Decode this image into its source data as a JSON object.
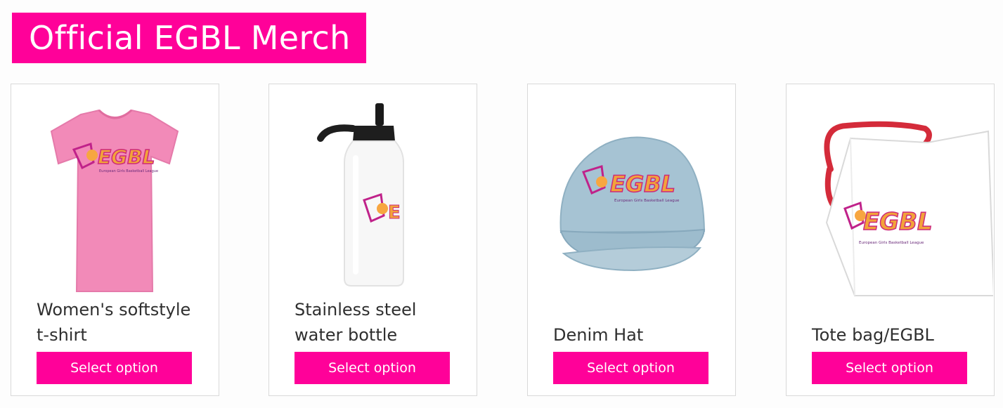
{
  "page": {
    "title": "Official EGBL Merch"
  },
  "colors": {
    "brand": "#ff0199",
    "card_border": "#d9d9d9"
  },
  "products": [
    {
      "name": "Women's softstyle t-shirt",
      "button": "Select option",
      "image_icon": "pink-tshirt-image"
    },
    {
      "name": "Stainless steel water bottle",
      "button": "Select option",
      "image_icon": "water-bottle-image"
    },
    {
      "name": "Denim Hat",
      "button": "Select option",
      "image_icon": "denim-cap-image"
    },
    {
      "name": "Tote bag/EGBL",
      "button": "Select option",
      "image_icon": "tote-bag-image"
    }
  ],
  "logo": {
    "text": "EGBL",
    "tagline": "European Girls Basketball League"
  }
}
